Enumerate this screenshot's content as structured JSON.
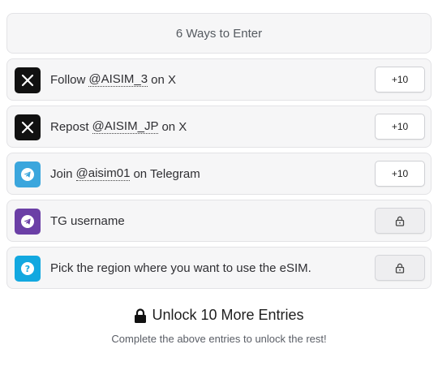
{
  "header": {
    "title": "6 Ways to Enter"
  },
  "entries": [
    {
      "icon": "x-logo-icon",
      "color": "#111111",
      "prefix": "Follow",
      "handle": "@AISIM_3",
      "suffix": "on X",
      "points": "+10",
      "locked": false
    },
    {
      "icon": "x-logo-icon",
      "color": "#111111",
      "prefix": "Repost",
      "handle": "@AISIM_JP",
      "suffix": "on X",
      "points": "+10",
      "locked": false
    },
    {
      "icon": "telegram-icon",
      "color": "#3ba6dd",
      "prefix": "Join",
      "handle": "@aisim01",
      "suffix": "on Telegram",
      "points": "+10",
      "locked": false
    },
    {
      "icon": "telegram-icon",
      "color": "#6b3fa6",
      "text": "TG username",
      "locked": true
    },
    {
      "icon": "question-icon",
      "color": "#12a8e0",
      "text": "Pick the region where you want to use the eSIM.",
      "locked": true
    }
  ],
  "unlock": {
    "title": "Unlock 10 More Entries",
    "subtitle": "Complete the above entries to unlock the rest!"
  }
}
